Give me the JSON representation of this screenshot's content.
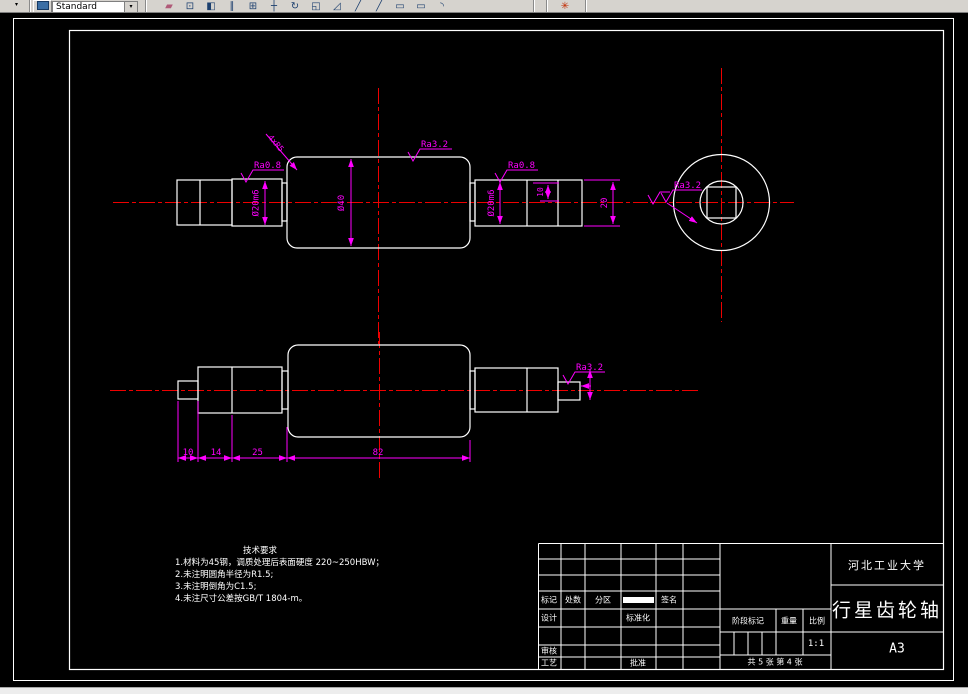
{
  "toolbar": {
    "style_name": "Standard",
    "dropdown_arrow": "▾",
    "icons": [
      {
        "name": "erase",
        "glyph": "▰"
      },
      {
        "name": "copy",
        "glyph": "⊡"
      },
      {
        "name": "mirror",
        "glyph": "◧"
      },
      {
        "name": "offset",
        "glyph": "∥"
      },
      {
        "name": "array",
        "glyph": "⊞"
      },
      {
        "name": "move",
        "glyph": "┼"
      },
      {
        "name": "rotate",
        "glyph": "↻"
      },
      {
        "name": "scale",
        "glyph": "◱"
      },
      {
        "name": "stretch",
        "glyph": "◿"
      },
      {
        "name": "trim",
        "glyph": "╱"
      },
      {
        "name": "extend",
        "glyph": "╱"
      },
      {
        "name": "break",
        "glyph": "▭"
      },
      {
        "name": "chamfer",
        "glyph": "▭"
      },
      {
        "name": "fillet",
        "glyph": "◝"
      },
      {
        "name": "explode",
        "glyph": "✳"
      }
    ]
  },
  "drawing": {
    "dimensions": {
      "dia20_left": "Ø20m6",
      "dia40": "Ø40",
      "dia20_right": "Ø20m6",
      "height10": "10",
      "height20": "20",
      "fillet_note": "4xR5",
      "len_10": "10",
      "len_14": "14",
      "len_25": "25",
      "len_82": "82"
    },
    "roughness": {
      "left": "Ra0.8",
      "top": "Ra3.2",
      "right": "Ra0.8",
      "end_view": "Ra3.2",
      "bottom_view": "Ra3.2"
    }
  },
  "tech_requirements": {
    "title": "技术要求",
    "items": [
      "1.材料为45钢，调质处理后表面硬度 220~250HBW；",
      "2.未注明圆角半径为R1.5;",
      "3.未注明倒角为C1.5;",
      "4.未注尺寸公差按GB/T 1804-m。"
    ]
  },
  "title_block": {
    "university": "河北工业大学",
    "part_name": "行星齿轮轴",
    "paper_size": "A3",
    "scale_value": "1:1",
    "sheet_info": "共 5 张  第 4 张",
    "labels": {
      "mark": "标记",
      "count": "处数",
      "zone": "分区",
      "signature": "签名",
      "design": "设计",
      "standardization": "标准化",
      "review": "审核",
      "process": "工艺",
      "approve": "批准",
      "stage_mark": "阶段标记",
      "weight": "重量",
      "scale": "比例"
    }
  },
  "colors": {
    "background": "#000000",
    "geometry": "#ffffff",
    "centerline": "#ee0000",
    "dimension": "#ff00ff",
    "toolbar": "#d6d3ce"
  }
}
